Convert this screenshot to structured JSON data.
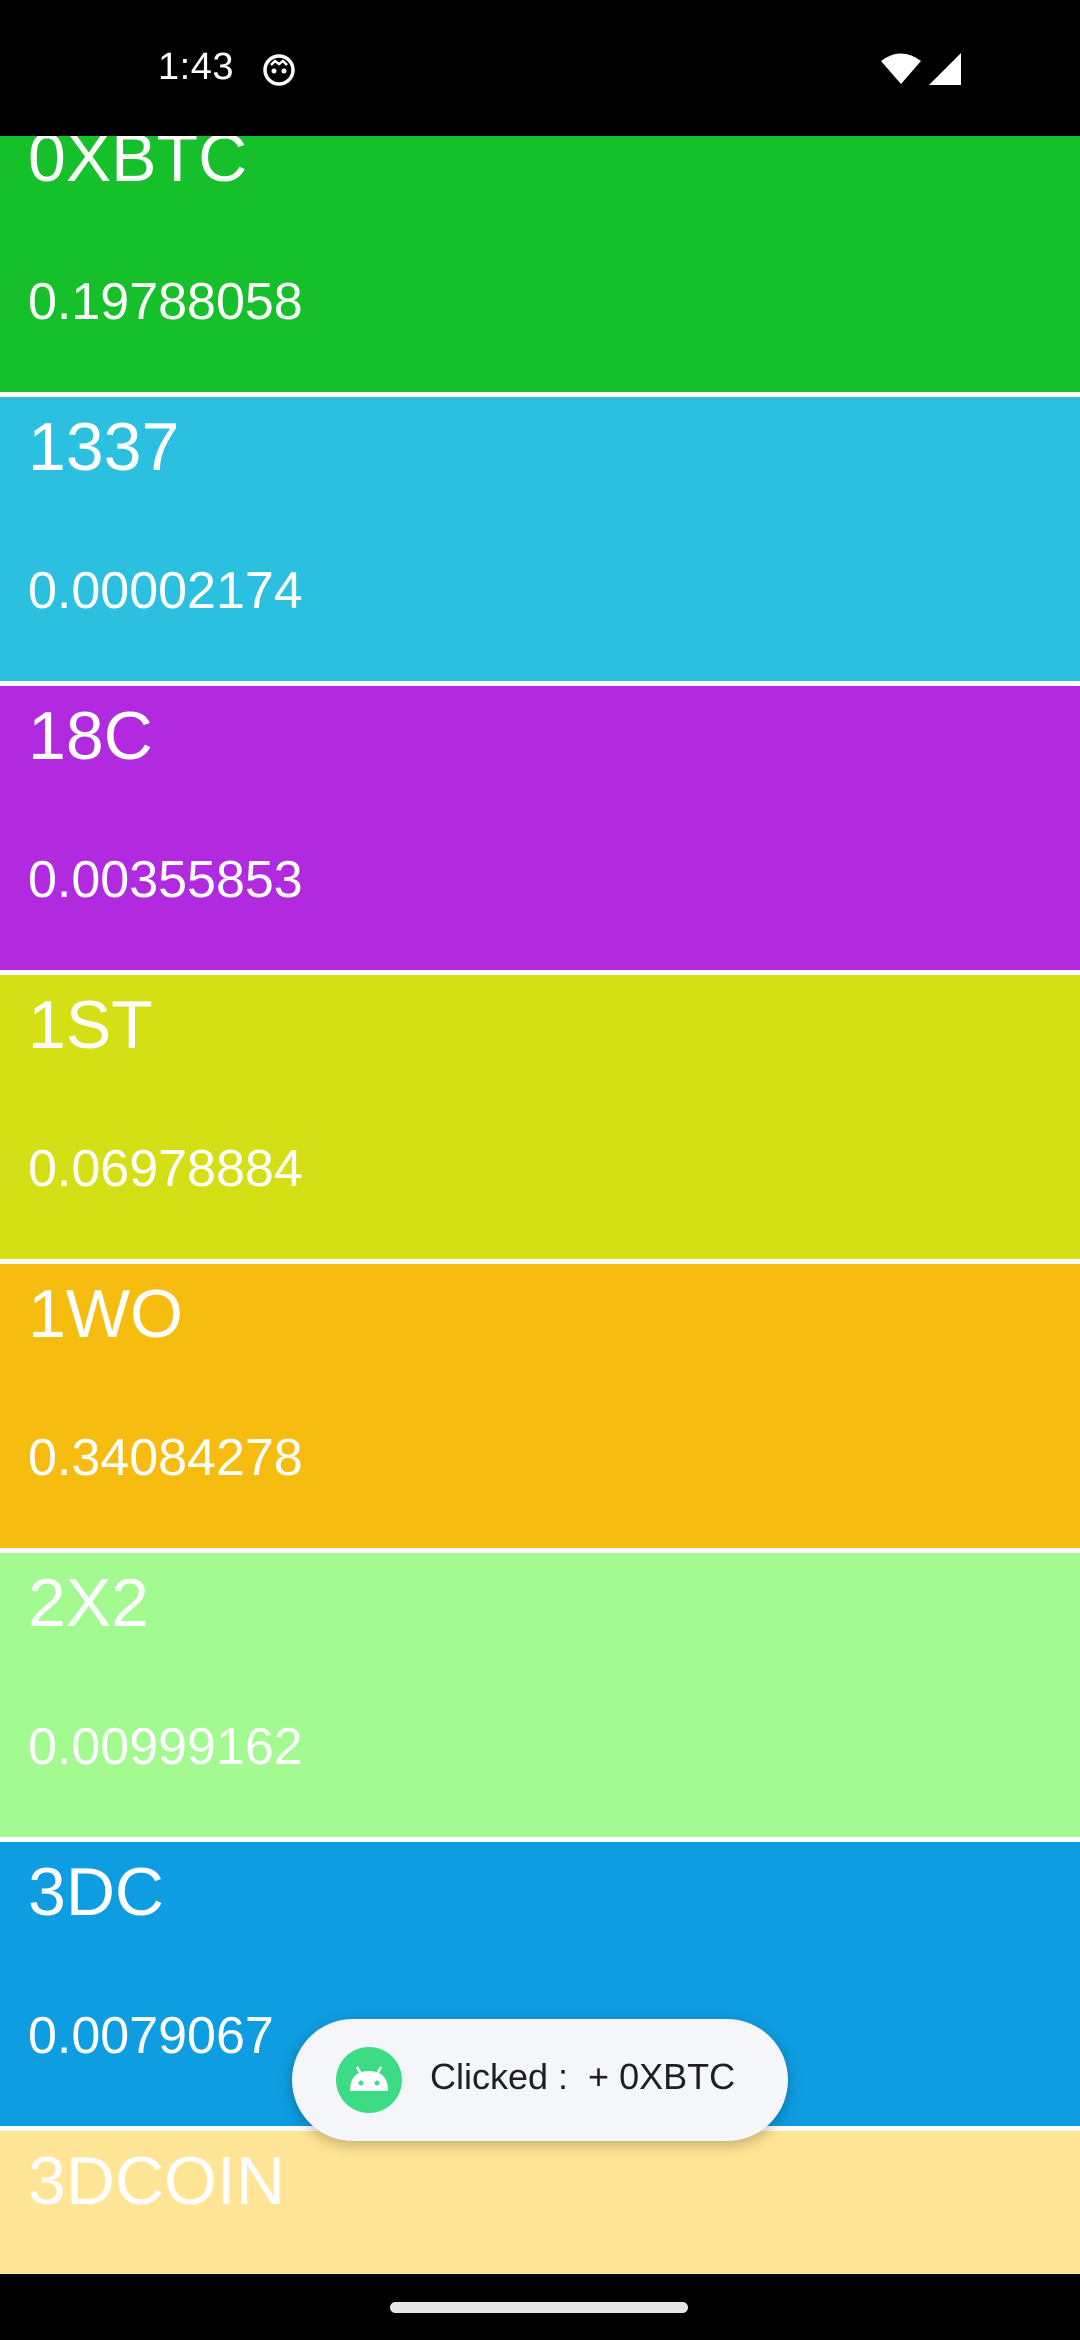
{
  "status_bar": {
    "time": "1:43",
    "icons": [
      "app-notification-icon",
      "wifi-icon",
      "cell-signal-icon"
    ]
  },
  "coins": [
    {
      "symbol": "0XBTC",
      "price": "0.19788058",
      "color": "#16c02a"
    },
    {
      "symbol": "1337",
      "price": "0.00002174",
      "color": "#2bc0e0"
    },
    {
      "symbol": "18C",
      "price": "0.00355853",
      "color": "#b22ae0"
    },
    {
      "symbol": "1ST",
      "price": "0.06978884",
      "color": "#d4e015"
    },
    {
      "symbol": "1WO",
      "price": "0.34084278",
      "color": "#f6bd10"
    },
    {
      "symbol": "2X2",
      "price": "0.00999162",
      "color": "#a2fa91"
    },
    {
      "symbol": "3DC",
      "price": "0.0079067",
      "color": "#0e9de0"
    },
    {
      "symbol": "3DCOIN",
      "price": "",
      "color": "#ffe595"
    }
  ],
  "toast": {
    "text": "Clicked :  + 0XBTC",
    "icon": "android-icon"
  },
  "nav": {
    "indicator": "home-indicator"
  }
}
